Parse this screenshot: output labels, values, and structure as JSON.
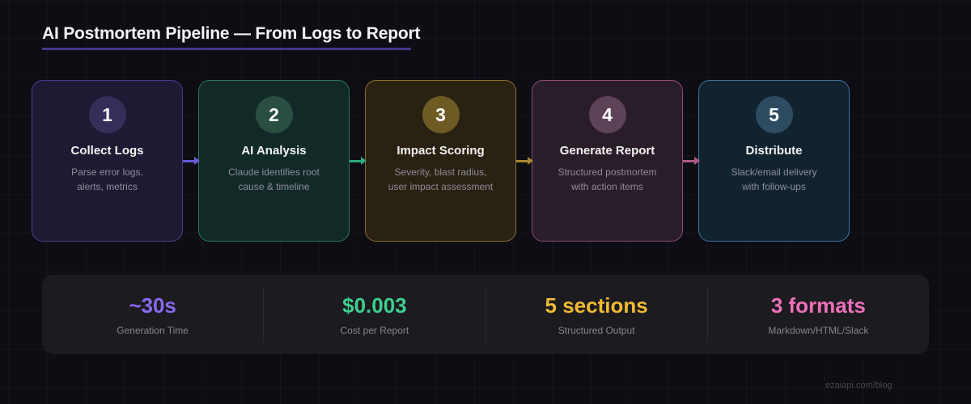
{
  "title": "AI Postmortem Pipeline — From Logs to Report",
  "steps": [
    {
      "number": "1",
      "title": "Collect Logs",
      "description": "Parse error logs,\nalerts, metrics",
      "colors": {
        "bg": "#1f1a33",
        "border": "#4a3d92",
        "badge": "#352e59",
        "arrow": "#665ad6"
      }
    },
    {
      "number": "2",
      "title": "AI Analysis",
      "description": "Claude identifies root\ncause & timeline",
      "colors": {
        "bg": "#112927",
        "border": "#2e7564",
        "badge": "#2b4e42",
        "arrow": "#2fa87e"
      }
    },
    {
      "number": "3",
      "title": "Impact Scoring",
      "description": "Severity, blast radius,\nuser impact assessment",
      "colors": {
        "bg": "#292112",
        "border": "#8f712c",
        "badge": "#6e5b24",
        "arrow": "#a8862e"
      }
    },
    {
      "number": "4",
      "title": "Generate Report",
      "description": "Structured postmortem\nwith action items",
      "colors": {
        "bg": "#2a1d2a",
        "border": "#8f4d77",
        "badge": "#5e4257",
        "arrow": "#b05a85"
      }
    },
    {
      "number": "5",
      "title": "Distribute",
      "description": "Slack/email delivery\nwith follow-ups",
      "colors": {
        "bg": "#122330",
        "border": "#40739c",
        "badge": "#2d4c62"
      }
    }
  ],
  "stats": [
    {
      "value": "~30s",
      "label": "Generation Time",
      "color": "#8a68ee"
    },
    {
      "value": "$0.003",
      "label": "Cost per Report",
      "color": "#3fcf8e"
    },
    {
      "value": "5 sections",
      "label": "Structured Output",
      "color": "#f0bb33"
    },
    {
      "value": "3 formats",
      "label": "Markdown/HTML/Slack",
      "color": "#ef70ba"
    }
  ],
  "watermark": "ezaiapi.com/blog",
  "theme": {
    "background": "#0d0d13",
    "panel": "#1b1b20",
    "title_underline": "#44388a",
    "title_color": "#f4f4f6",
    "label_color": "#85858e"
  }
}
